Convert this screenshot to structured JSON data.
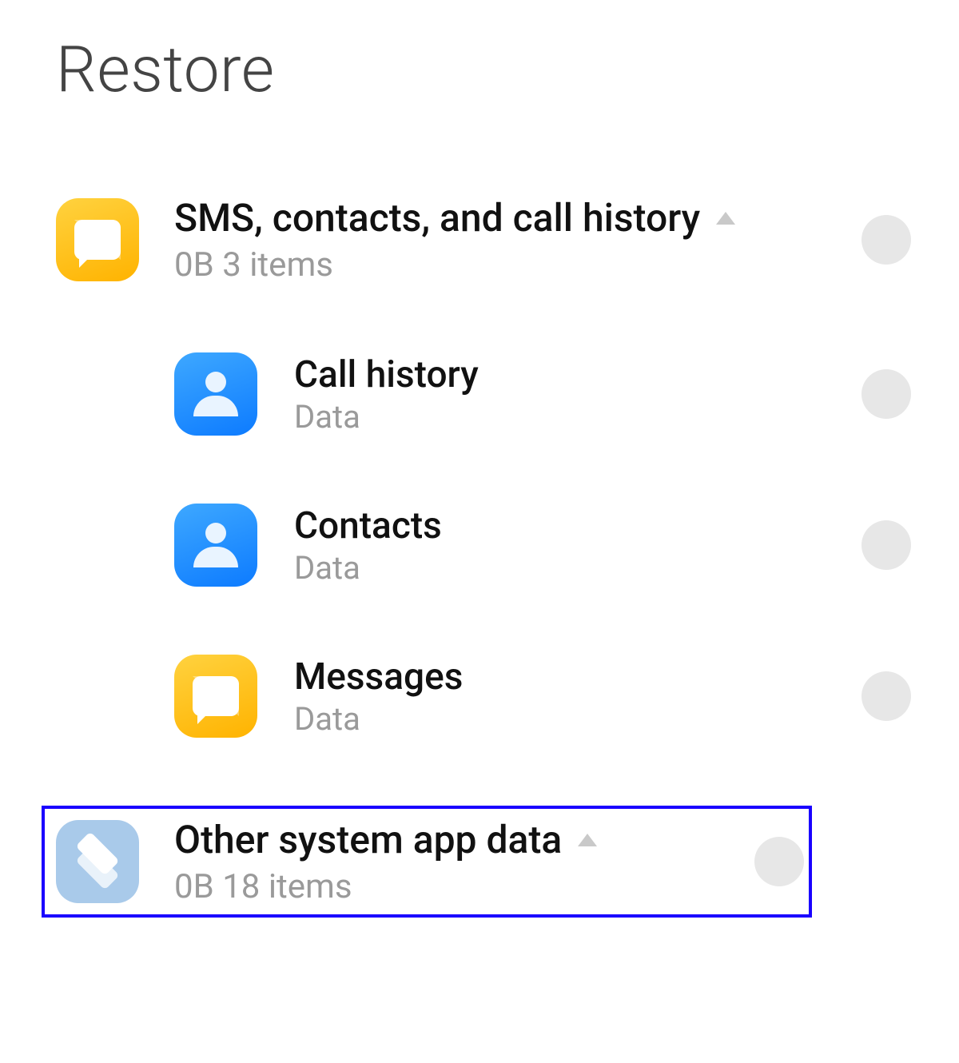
{
  "page": {
    "title": "Restore"
  },
  "groups": [
    {
      "icon": "messages-icon",
      "title": "SMS, contacts, and call history",
      "sub": "0B  3 items",
      "expanded": true,
      "selected": false,
      "children": [
        {
          "icon": "person-icon",
          "title": "Call history",
          "sub": "Data",
          "selected": false
        },
        {
          "icon": "person-icon",
          "title": "Contacts",
          "sub": "Data",
          "selected": false
        },
        {
          "icon": "messages-icon",
          "title": "Messages",
          "sub": "Data",
          "selected": false
        }
      ]
    },
    {
      "icon": "layers-icon",
      "title": "Other system app data",
      "sub": "0B  18 items",
      "expanded": true,
      "selected": false,
      "highlighted": true
    }
  ]
}
